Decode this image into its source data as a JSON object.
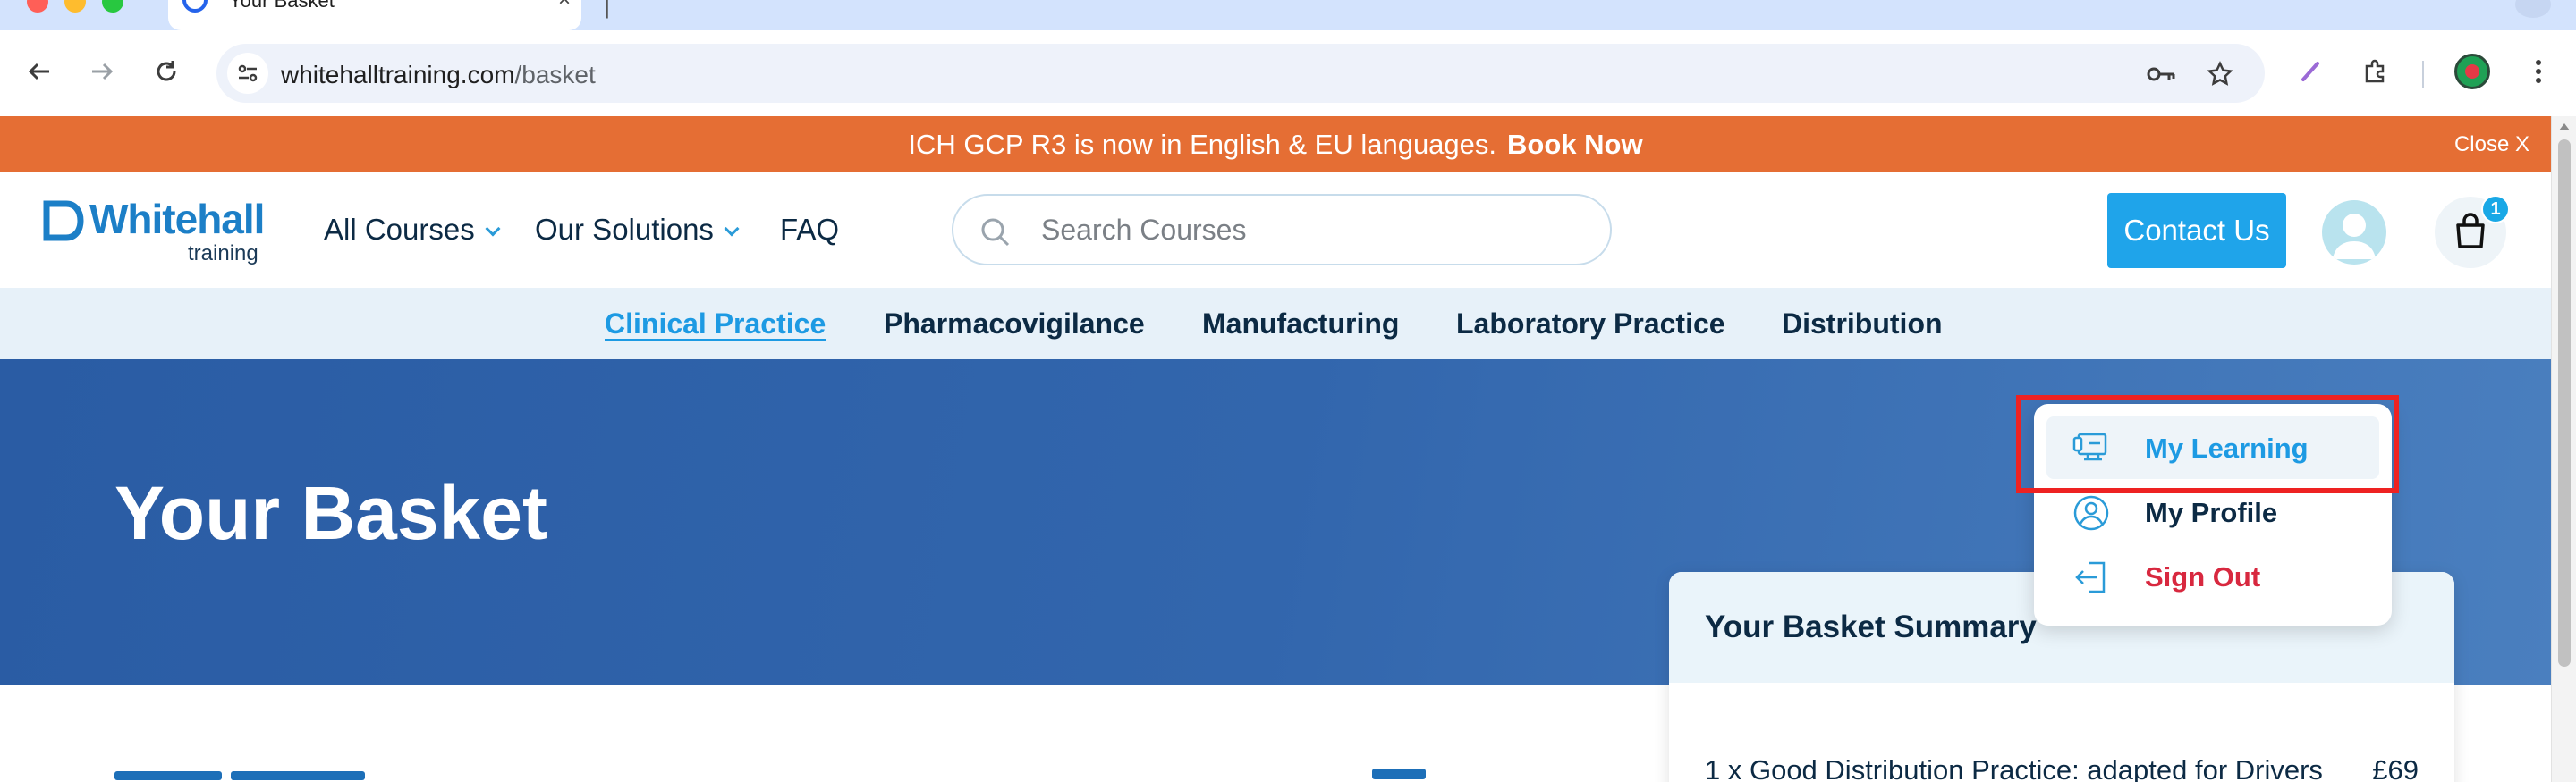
{
  "browser": {
    "tab_title": "Your Basket",
    "tab_close": "×",
    "url_domain": "whitehalltraining.com",
    "url_path": "/basket"
  },
  "announcement": {
    "text": "ICH GCP R3 is now in English & EU languages.",
    "cta": "Book Now",
    "close": "Close X"
  },
  "header": {
    "logo_word": "Whitehall",
    "logo_sub": "training",
    "nav": [
      {
        "label": "All Courses"
      },
      {
        "label": "Our Solutions"
      },
      {
        "label": "FAQ"
      }
    ],
    "search_placeholder": "Search Courses",
    "contact_label": "Contact Us",
    "basket_count": "1"
  },
  "subnav": {
    "items": [
      {
        "label": "Clinical Practice",
        "active": true
      },
      {
        "label": "Pharmacovigilance"
      },
      {
        "label": "Manufacturing"
      },
      {
        "label": "Laboratory Practice"
      },
      {
        "label": "Distribution"
      }
    ]
  },
  "hero": {
    "title": "Your Basket"
  },
  "summary": {
    "title": "Your Basket Summary",
    "line": "1 x Good Distribution Practice: adapted for Drivers",
    "price": "£69"
  },
  "user_menu": {
    "items": [
      {
        "label": "My Learning",
        "icon": "learning-icon",
        "color": "#1d9ae3"
      },
      {
        "label": "My Profile",
        "icon": "profile-icon",
        "color": "#0c2a44"
      },
      {
        "label": "Sign Out",
        "icon": "sign-out-icon",
        "color": "#d8283f"
      }
    ]
  },
  "colors": {
    "announcement_bg": "#e56e34",
    "accent": "#1fa4ea",
    "hero_bg": "#2a5ca4",
    "highlight": "#ee2222"
  }
}
